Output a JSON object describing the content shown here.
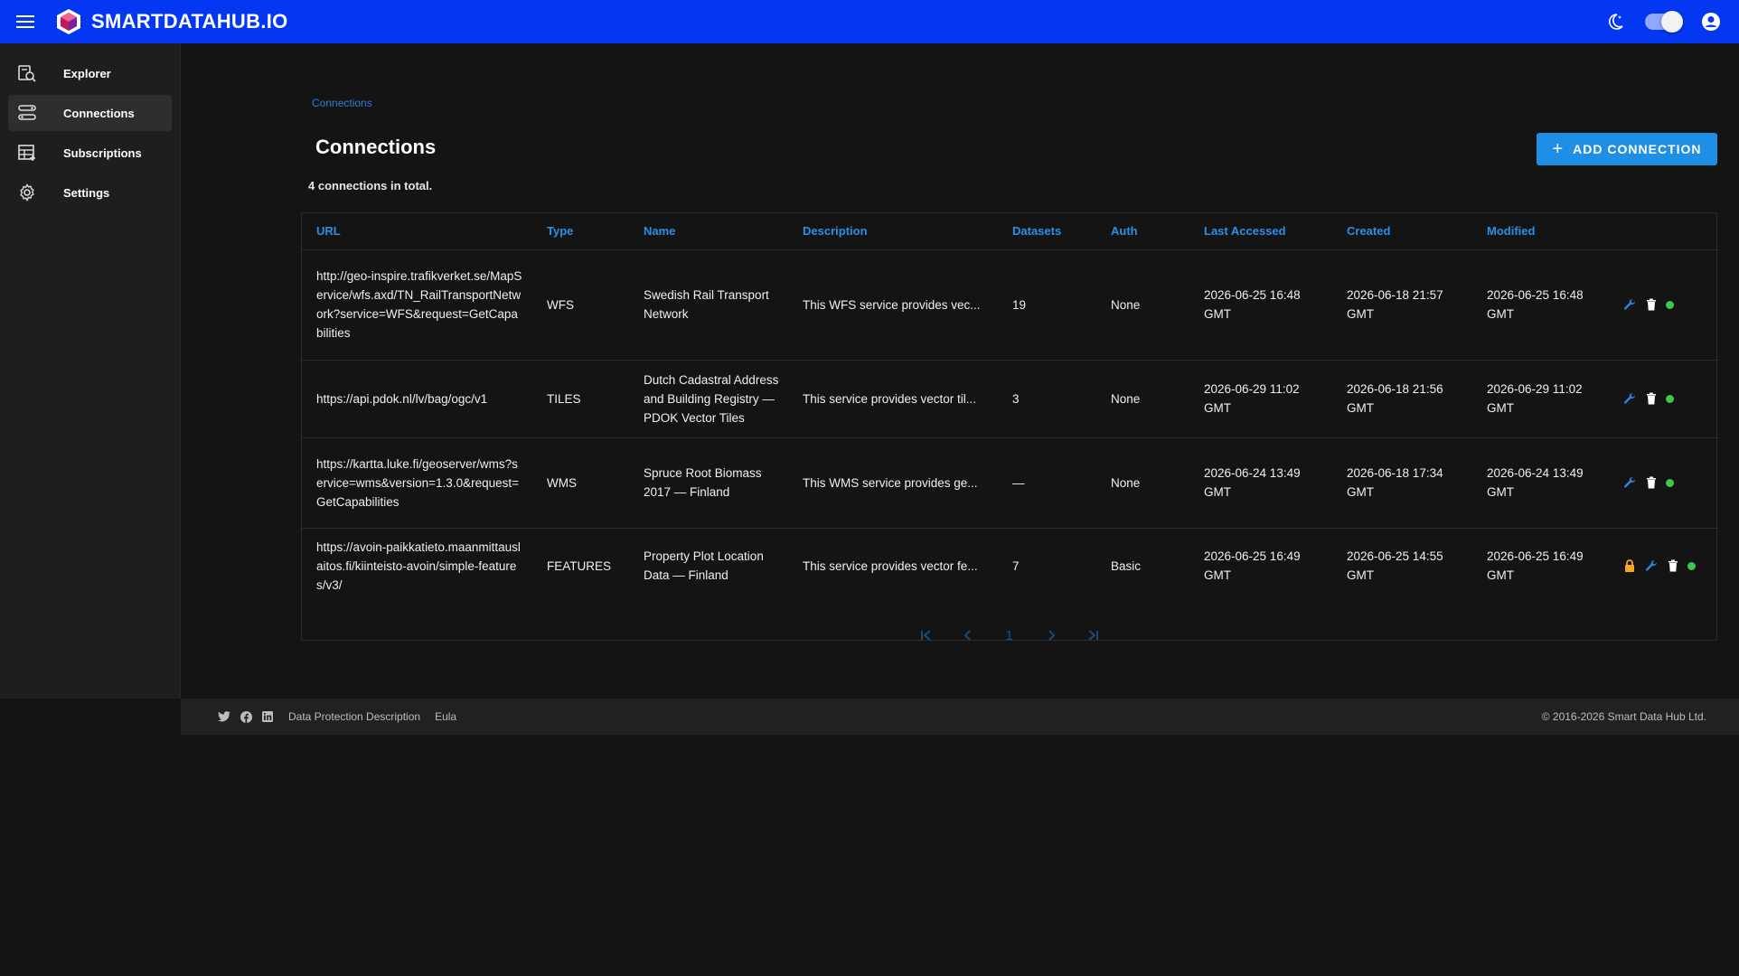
{
  "app": {
    "brand": "SMARTDATAHUB.IO"
  },
  "sidebar": {
    "items": [
      {
        "label": "Explorer",
        "icon": "explorer-search-icon"
      },
      {
        "label": "Connections",
        "icon": "connections-icon",
        "active": true
      },
      {
        "label": "Subscriptions",
        "icon": "subscriptions-icon"
      },
      {
        "label": "Settings",
        "icon": "gear-icon"
      }
    ]
  },
  "page": {
    "breadcrumb": "Connections",
    "title": "Connections",
    "add_button_label": "ADD CONNECTION",
    "total_text": "4 connections in total."
  },
  "table": {
    "headers": [
      "URL",
      "Type",
      "Name",
      "Description",
      "Datasets",
      "Auth",
      "Last Accessed",
      "Created",
      "Modified"
    ],
    "rows": [
      {
        "url": "http://geo-inspire.trafikverket.se/MapService/wfs.axd/TN_RailTransportNetwork?service=WFS&request=GetCapabilities",
        "type": "WFS",
        "name": "Swedish Rail Transport Network",
        "description": "This WFS service provides vec...",
        "datasets": "19",
        "auth": "None",
        "last_accessed": "2026-06-25 16:48 GMT",
        "created": "2026-06-18 21:57 GMT",
        "modified": "2026-06-25 16:48 GMT",
        "locked": false
      },
      {
        "url": "https://api.pdok.nl/lv/bag/ogc/v1",
        "type": "TILES",
        "name": "Dutch Cadastral Address and Building Registry — PDOK Vector Tiles",
        "description": "This service provides vector til...",
        "datasets": "3",
        "auth": "None",
        "last_accessed": "2026-06-29 11:02 GMT",
        "created": "2026-06-18 21:56 GMT",
        "modified": "2026-06-29 11:02 GMT",
        "locked": false
      },
      {
        "url": "https://kartta.luke.fi/geoserver/wms?service=wms&version=1.3.0&request=GetCapabilities",
        "type": "WMS",
        "name": "Spruce Root Biomass 2017 — Finland",
        "description": "This WMS service provides ge...",
        "datasets": "—",
        "auth": "None",
        "last_accessed": "2026-06-24 13:49 GMT",
        "created": "2026-06-18 17:34 GMT",
        "modified": "2026-06-24 13:49 GMT",
        "locked": false
      },
      {
        "url": "https://avoin-paikkatieto.maanmittauslaitos.fi/kiinteisto-avoin/simple-features/v3/",
        "type": "FEATURES",
        "name": "Property Plot Location Data — Finland",
        "description": "This service provides vector fe...",
        "datasets": "7",
        "auth": "Basic",
        "last_accessed": "2026-06-25 16:49 GMT",
        "created": "2026-06-25 14:55 GMT",
        "modified": "2026-06-25 16:49 GMT",
        "locked": true
      }
    ]
  },
  "pagination": {
    "current_page": "1"
  },
  "footer": {
    "links": [
      "Data Protection Description",
      "Eula"
    ],
    "copyright": "© 2016-2026 Smart Data Hub Ltd."
  },
  "colors": {
    "topbar": "#0437f2",
    "accent": "#1f8fe5",
    "status_ok": "#3ec84b",
    "lock": "#f5a623"
  }
}
